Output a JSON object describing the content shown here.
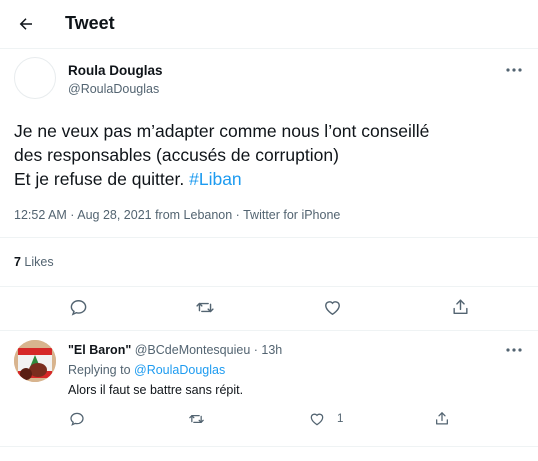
{
  "header": {
    "title": "Tweet"
  },
  "tweet": {
    "author_name": "Roula Douglas",
    "author_handle": "@RoulaDouglas",
    "text_lines": [
      "Je ne veux pas m’adapter comme nous l’ont conseillé",
      "des responsables (accusés de corruption)",
      "Et je refuse de quitter. "
    ],
    "hashtag": "#Liban",
    "meta": "12:52 AM · Aug 28, 2021 from Lebanon · Twitter for iPhone",
    "likes_count": "7",
    "likes_label": " Likes"
  },
  "reply": {
    "name": "\"El Baron\"",
    "handle_time": " @BCdeMontesquieu · 13h",
    "replying_prefix": "Replying to ",
    "replying_to": "@RoulaDouglas",
    "text": "Alors il faut se battre sans répit.",
    "like_count": "1"
  },
  "icons": {
    "back": "arrow-left-icon",
    "more": "more-dots-icon",
    "reply": "comment-icon",
    "retweet": "retweet-icon",
    "like": "heart-icon",
    "share": "share-icon"
  },
  "colors": {
    "accent": "#1d9bf0",
    "text": "#0f1419",
    "secondary": "#536471",
    "divider": "#eff3f4"
  }
}
